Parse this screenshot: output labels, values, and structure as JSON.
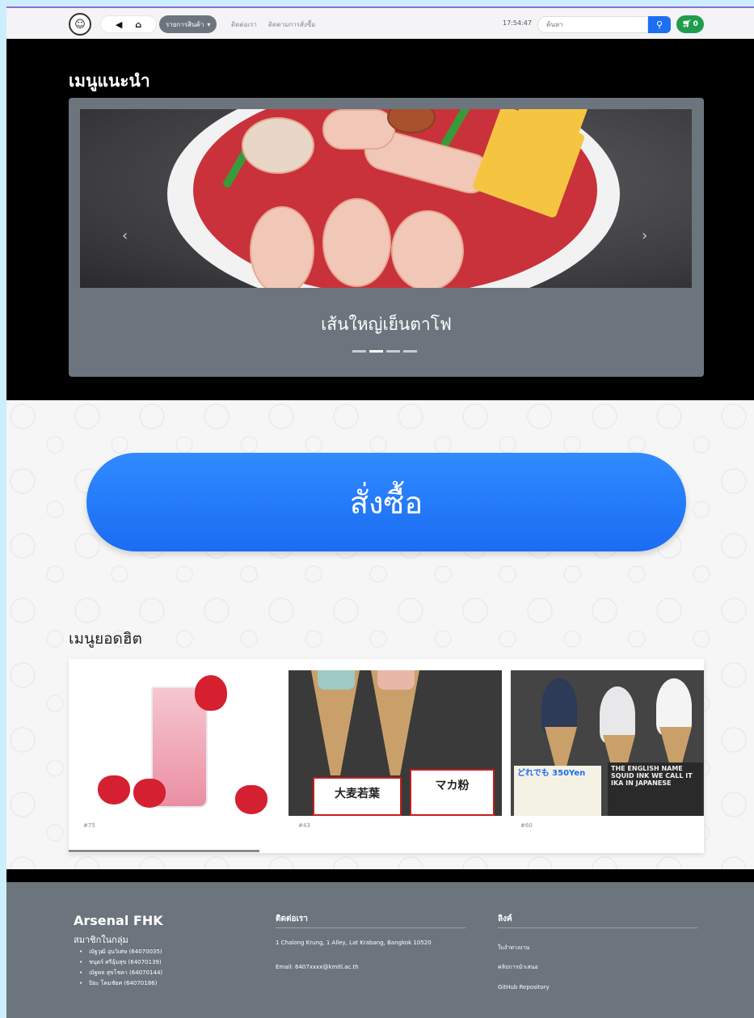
{
  "navbar": {
    "nav_back": "◀",
    "nav_home": "⌂",
    "products_label": "รายการสินค้า",
    "contact_link": "ติดต่อเรา",
    "status_link": "ติดตามการสั่งซื้อ",
    "clock": "17:54:47",
    "search_placeholder": "ค้นหา",
    "cart_count": "0"
  },
  "recommend": {
    "title": "เมนูแนะนำ",
    "caption": "เส้นใหญ่เย็นตาโฟ",
    "slides_total": 4,
    "active_slide": 1
  },
  "order": {
    "button_label": "สั่งซื้อ"
  },
  "hot": {
    "title": "เมนูยอดฮิต",
    "cards": [
      {
        "id": "#75"
      },
      {
        "id": "#43"
      },
      {
        "id": "#60"
      }
    ],
    "card2_sign_left": "大麦若葉",
    "card2_sign_right": "マカ粉",
    "card3_board_left": "どれでも 350Yen",
    "card3_board_right": "THE ENGLISH NAME SQUID INK WE CALL IT IKA IN JAPANESE"
  },
  "footer": {
    "brand": "Arsenal FHK",
    "members_title": "สมาชิกในกลุ่ม",
    "members": [
      "ณัฐวุฒิ อุ่นวิเศษ (64070035)",
      "ชนุตร์ ศรีอุ้มสุข (64070139)",
      "ณัฐพล สุขโชคา (64070144)",
      "ปิยะ โคมชัยศ (64070186)"
    ],
    "contact_title": "ติดต่อเรา",
    "address": "1 Chalong Krung, 1 Alley, Lat Krabang, Bangkok 10520",
    "email": "Email: 6407xxxx@kmitl.ac.th",
    "links_title": "ลิงค์",
    "links": [
      "ใบงำทางงาน",
      "คลิปการนำเสนอ",
      "GitHub Repository"
    ]
  },
  "colors": {
    "accent_blue": "#1b6cf2",
    "cart_green": "#1f9d4c",
    "footer_gray": "#6c757d"
  }
}
